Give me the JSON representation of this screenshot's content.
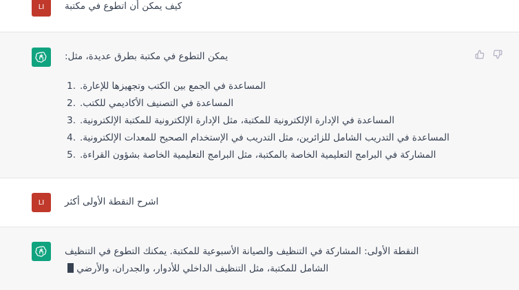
{
  "conversation": {
    "user1": {
      "avatar": "LI",
      "text": "كيف يمكن أن اتطوع في مكتبة"
    },
    "assistant1": {
      "intro": "يمكن التطوع في مكتبة بطرق عديدة، مثل:",
      "items": [
        {
          "num": "1.",
          "text": "المساعدة في الجمع بين الكتب وتجهيزها للإعارة."
        },
        {
          "num": "2.",
          "text": "المساعدة في التصنيف الأكاديمي للكتب."
        },
        {
          "num": "3.",
          "text": "المساعدة في الإدارة الإلكترونية للمكتبة، مثل الإدارة الإلكترونية للمكتبة الإلكترونية."
        },
        {
          "num": "4.",
          "text": "المساعدة في التدريب الشامل للزائرين، مثل التدريب في الإستخدام الصحيح للمعدات الإلكترونية."
        },
        {
          "num": "5.",
          "text": "المشاركة في البرامج التعليمية الخاصة بالمكتبة، مثل البرامج التعليمية الخاصة بشؤون القراءة."
        }
      ]
    },
    "user2": {
      "avatar": "LI",
      "text": "اشرح النقطة الأولى أكثر"
    },
    "assistant2": {
      "line1": "النقطة الأولى: المشاركة في التنظيف والصيانة الأسبوعية للمكتبة. يمكنك التطوع في التنظيف",
      "line2": "الشامل للمكتبة، مثل التنظيف الداخلي للأدوار، والجدران، والأرضي"
    }
  },
  "colors": {
    "user_avatar": "#c0392b",
    "assistant_avatar": "#10a37f",
    "assistant_bg": "#f7f7f8"
  },
  "icons": {
    "assistant_logo": "openai-logo-icon",
    "thumbs_up": "thumbs-up-icon",
    "thumbs_down": "thumbs-down-icon"
  }
}
